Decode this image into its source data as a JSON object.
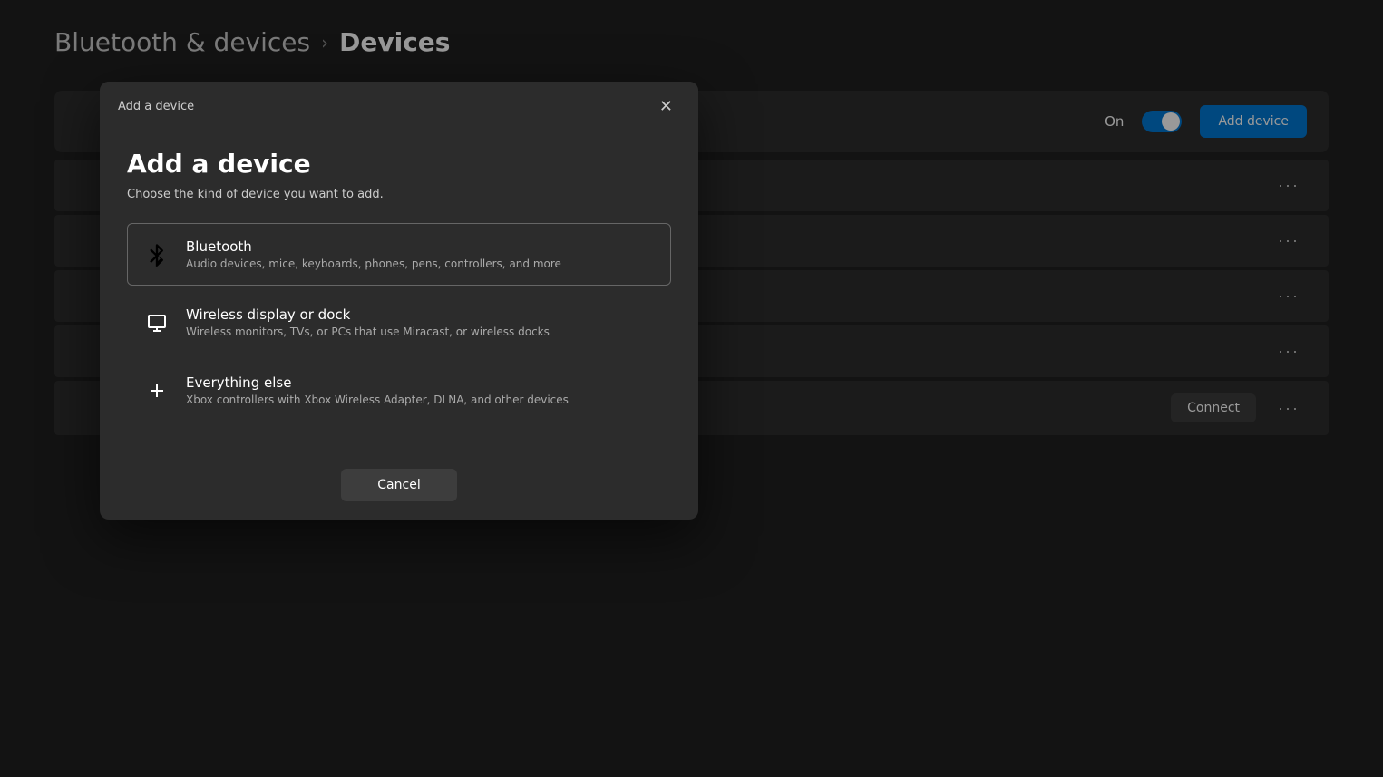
{
  "breadcrumb": {
    "parent": "Bluetooth & devices",
    "separator": "›",
    "current": "Devices"
  },
  "header": {
    "toggle_label": "On",
    "add_device_button": "Add device"
  },
  "device_rows": [
    {
      "id": 1
    },
    {
      "id": 2
    },
    {
      "id": 3
    },
    {
      "id": 4
    }
  ],
  "last_device_row": {
    "connect_label": "Connect",
    "more_label": "···"
  },
  "dialog": {
    "title": "Add a device",
    "close_label": "✕",
    "heading": "Add a device",
    "subtitle": "Choose the kind of device you want to add.",
    "options": [
      {
        "id": "bluetooth",
        "icon_name": "bluetooth-icon",
        "title": "Bluetooth",
        "description": "Audio devices, mice, keyboards, phones, pens, controllers, and more",
        "selected": true
      },
      {
        "id": "wireless-display",
        "icon_name": "monitor-icon",
        "title": "Wireless display or dock",
        "description": "Wireless monitors, TVs, or PCs that use Miracast, or wireless docks",
        "selected": false
      },
      {
        "id": "everything-else",
        "icon_name": "plus-icon",
        "title": "Everything else",
        "description": "Xbox controllers with Xbox Wireless Adapter, DLNA, and other devices",
        "selected": false
      }
    ],
    "cancel_label": "Cancel"
  },
  "more_dots": "···"
}
